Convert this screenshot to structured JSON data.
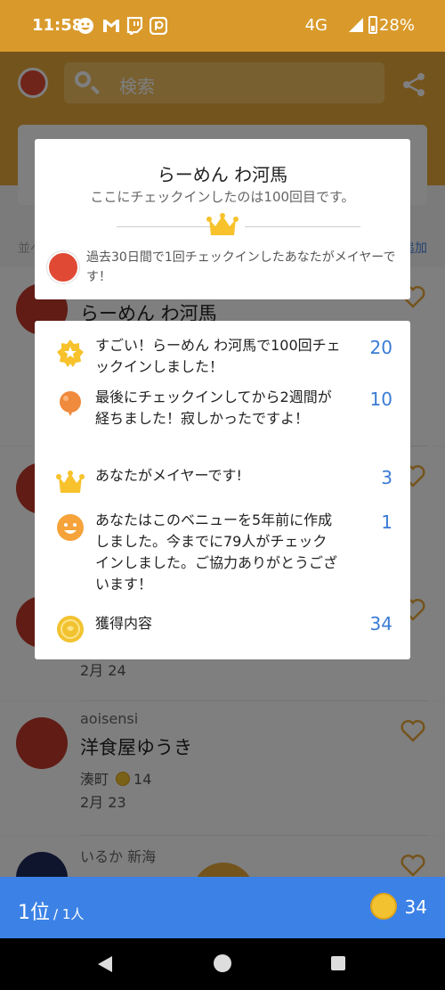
{
  "status_bar": {
    "time": "11:58",
    "network": "4G",
    "battery": "28%",
    "notification_icons": [
      "smiley-icon",
      "gmail-icon",
      "twitch-icon",
      "patreon-icon"
    ]
  },
  "header": {
    "search_placeholder": "検索"
  },
  "background": {
    "sort_label": "並べ",
    "add_label": "追加",
    "entries": [
      {
        "user": "",
        "venue": "らーめん わ河馬",
        "location": "",
        "coins": "",
        "date": ""
      },
      {
        "user": "",
        "venue": "",
        "location": "",
        "coins": "",
        "date": "2月 24"
      },
      {
        "user": "aoisensi",
        "venue": "洋食屋ゆうき",
        "location": "湊町",
        "coins": "14",
        "date": "2月 23"
      },
      {
        "user": "いるか 新海",
        "venue": "",
        "location": "",
        "coins": "",
        "date": ""
      }
    ]
  },
  "checkin_modal": {
    "title": "らーめん わ河馬",
    "subtitle": "ここにチェックインしたのは100回目です。",
    "mayor_text": "過去30日間で1回チェックインしたあなたがメイヤーです！"
  },
  "rewards": [
    {
      "icon": "star-badge-icon",
      "text": "すごい！らーめん わ河馬で100回チェックインしました！",
      "points": "20"
    },
    {
      "icon": "balloon-icon",
      "text": "最後にチェックインしてから2週間が経ちました！寂しかったですよ！",
      "points": "10"
    },
    {
      "icon": "crown-icon",
      "text": "あなたがメイヤーです!",
      "points": "3"
    },
    {
      "icon": "smiley-face-icon",
      "text": "あなたはこのベニューを5年前に作成しました。今までに79人がチェックインしました。ご協力ありがとうございます！",
      "points": "1"
    },
    {
      "icon": "coin-icon",
      "text": "獲得内容",
      "points": "34"
    }
  ],
  "bottom_bar": {
    "rank": "1位",
    "rank_of": "/ 1人",
    "total_coins": "34"
  },
  "colors": {
    "accent_orange": "#e8a83a",
    "blue": "#3c82e6",
    "points_blue": "#3a7bd5",
    "coin_yellow": "#f2c230"
  }
}
